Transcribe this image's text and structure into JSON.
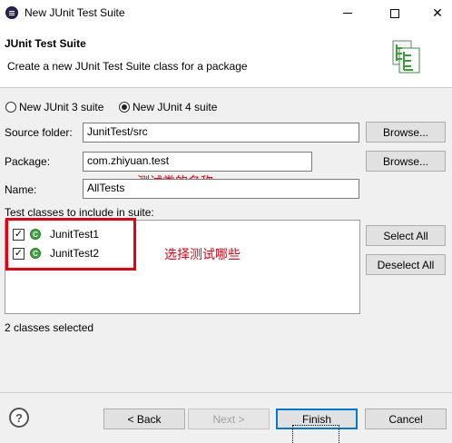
{
  "window": {
    "title": "New JUnit Test Suite",
    "minimize_label": "",
    "maximize_label": "",
    "close_label": "✕"
  },
  "header": {
    "title": "JUnit Test Suite",
    "description": "Create a new JUnit Test Suite class for a package"
  },
  "radios": [
    {
      "label": "New JUnit 3 suite",
      "checked": false
    },
    {
      "label": "New JUnit 4 suite",
      "checked": true
    }
  ],
  "fields": {
    "source_folder": {
      "label": "Source folder:",
      "value": "JunitTest/src",
      "browse": "Browse..."
    },
    "package": {
      "label": "Package:",
      "value": "com.zhiyuan.test",
      "browse": "Browse..."
    },
    "name": {
      "label": "Name:",
      "value": "AllTests"
    }
  },
  "annotations": {
    "name_note": "测试类的名称",
    "select_note": "选择测试哪些"
  },
  "test_classes": {
    "label": "Test classes to include in suite:",
    "items": [
      {
        "name": "JunitTest1",
        "checked": true
      },
      {
        "name": "JunitTest2",
        "checked": true
      }
    ],
    "select_all": "Select All",
    "deselect_all": "Deselect All",
    "status": "2 classes selected"
  },
  "footer": {
    "back": "< Back",
    "next": "Next >",
    "finish": "Finish",
    "cancel": "Cancel"
  },
  "icons": {
    "help": "?",
    "class_glyph": "C",
    "check_glyph": "✓"
  }
}
